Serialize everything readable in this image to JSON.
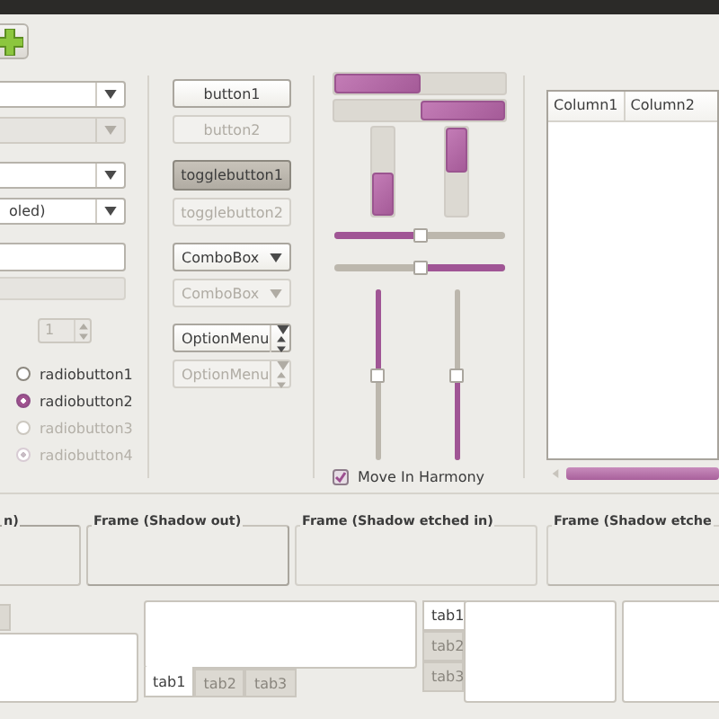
{
  "toolbar": {
    "buttons": [
      {
        "kind": "add"
      }
    ]
  },
  "left": {
    "combos": [
      {
        "disabled": false
      },
      {
        "disabled": true
      },
      {
        "disabled": false
      },
      {
        "disabled": false,
        "value": "oled)"
      }
    ],
    "entries": [
      {
        "disabled": false
      },
      {
        "disabled": true
      }
    ],
    "spin": {
      "value": "1",
      "disabled": true
    },
    "radios": [
      {
        "label": "radiobutton1",
        "selected": false,
        "disabled": false
      },
      {
        "label": "radiobutton2",
        "selected": true,
        "disabled": false
      },
      {
        "label": "radiobutton3",
        "selected": false,
        "disabled": true
      },
      {
        "label": "radiobutton4",
        "selected": true,
        "disabled": true
      }
    ]
  },
  "buttons": [
    {
      "kind": "button",
      "label": "button1",
      "disabled": false,
      "pressed": false
    },
    {
      "kind": "button",
      "label": "button2",
      "disabled": true,
      "pressed": false
    },
    {
      "kind": "toggle",
      "label": "togglebutton1",
      "disabled": false,
      "pressed": true
    },
    {
      "kind": "toggle",
      "label": "togglebutton2",
      "disabled": true,
      "pressed": false
    },
    {
      "kind": "combo",
      "label": "ComboBox",
      "disabled": false
    },
    {
      "kind": "combo",
      "label": "ComboBox",
      "disabled": true
    },
    {
      "kind": "option",
      "label": "OptionMenu",
      "disabled": false
    },
    {
      "kind": "option",
      "label": "OptionMenu",
      "disabled": true
    }
  ],
  "progress": [
    {
      "kind": "ltr",
      "level": 0.5
    },
    {
      "kind": "rtl",
      "level": 0.5
    },
    {
      "kind": "btt",
      "level": 0.5
    },
    {
      "kind": "ttb",
      "level": 0.5
    }
  ],
  "sliders": [
    {
      "kind": "ltr",
      "level": 0.5
    },
    {
      "kind": "rtl",
      "level": 0.5
    },
    {
      "kind": "ttb",
      "level": 0.5
    },
    {
      "kind": "btt",
      "level": 0.5
    }
  ],
  "harmony": {
    "label": "Move In Harmony",
    "checked": true
  },
  "tree": {
    "columns": [
      "Column1",
      "Column2"
    ]
  },
  "frames": [
    {
      "label": "n)",
      "kind": "in"
    },
    {
      "label": "Frame (Shadow out)",
      "kind": "out"
    },
    {
      "label": "Frame (Shadow etched in)",
      "kind": "etched-in"
    },
    {
      "label": "Frame (Shadow etche",
      "kind": "etched-out"
    }
  ],
  "notebooks": [
    {
      "kind": "top"
    },
    {
      "kind": "bottom",
      "tabs": [
        {
          "label": "tab1",
          "selected": true
        },
        {
          "label": "tab2",
          "selected": false
        },
        {
          "label": "tab3",
          "selected": false
        }
      ]
    },
    {
      "kind": "left",
      "tabs": [
        {
          "label": "tab1",
          "selected": true
        },
        {
          "label": "tab2",
          "selected": false
        },
        {
          "label": "tab3",
          "selected": false
        }
      ]
    },
    {
      "kind": "right"
    }
  ]
}
